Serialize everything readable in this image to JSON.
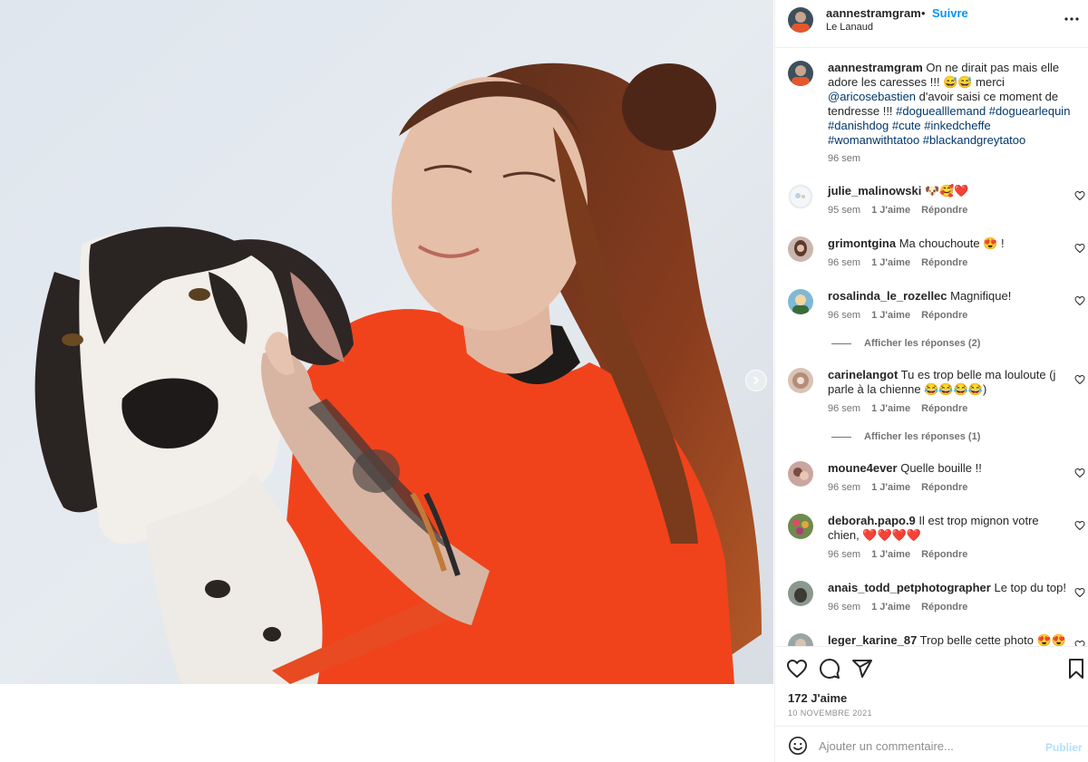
{
  "header": {
    "username": "aannestramgram",
    "separator": "•",
    "follow_label": "Suivre",
    "location": "Le Lanaud"
  },
  "caption": {
    "username": "aannestramgram",
    "text1": " On ne dirait pas mais elle adore les caresses !!! 😅😅 merci ",
    "mention": "@aricosebastien",
    "text2": " d'avoir saisi ce moment de tendresse !!! ",
    "hashtags": "#doguealllemand #doguearlequin #danishdog #cute #inkedcheffe #womanwithtatoo #blackandgreytatoo",
    "time": "96 sem"
  },
  "comments": [
    {
      "username": "julie_malinowski",
      "text": " 🐶🥰❤️",
      "time": "95 sem",
      "likes": "1 J'aime",
      "reply": "Répondre"
    },
    {
      "username": "grimontgina",
      "text": " Ma chouchoute 😍 !",
      "time": "96 sem",
      "likes": "1 J'aime",
      "reply": "Répondre"
    },
    {
      "username": "rosalinda_le_rozellec",
      "text": " Magnifique!",
      "time": "96 sem",
      "likes": "1 J'aime",
      "reply": "Répondre",
      "replies": "Afficher les réponses (2)"
    },
    {
      "username": "carinelangot",
      "text": " Tu es trop belle ma louloute (j parle à la chienne 😂😂😂😂)",
      "time": "96 sem",
      "likes": "1 J'aime",
      "reply": "Répondre",
      "replies": "Afficher les réponses (1)"
    },
    {
      "username": "moune4ever",
      "text": " Quelle bouille !!",
      "time": "96 sem",
      "likes": "1 J'aime",
      "reply": "Répondre"
    },
    {
      "username": "deborah.papo.9",
      "text": " Il est trop mignon votre chien, ❤️❤️❤️❤️",
      "time": "96 sem",
      "likes": "1 J'aime",
      "reply": "Répondre"
    },
    {
      "username": "anais_todd_petphotographer",
      "text": " Le top du top!",
      "time": "96 sem",
      "likes": "1 J'aime",
      "reply": "Répondre"
    },
    {
      "username": "leger_karine_87",
      "text": " Trop belle cette photo 😍😍"
    }
  ],
  "actions": {
    "likes": "172 J'aime",
    "date": "10 NOVEMBRE 2021"
  },
  "add_comment": {
    "placeholder": "Ajouter un commentaire...",
    "publish_label": "Publier"
  },
  "icons": [
    "heart-icon",
    "comment-icon",
    "share-icon",
    "bookmark-icon",
    "emoji-icon",
    "more-icon",
    "chevron-right-icon"
  ]
}
